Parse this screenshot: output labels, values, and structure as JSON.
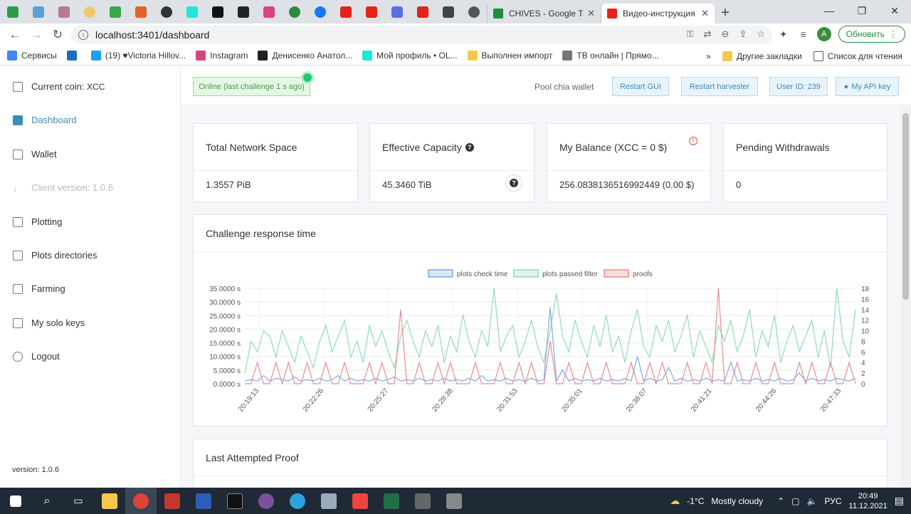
{
  "browser": {
    "tab_full_1": {
      "title": "CHIVES - Google Ta"
    },
    "tab_full_2": {
      "title": "Видео-инструкция"
    },
    "url": "localhost:3401/dashboard",
    "update_label": "Обновить",
    "avatar_letter": "A"
  },
  "bookmarks": {
    "items": [
      "Сервисы",
      "(19) ♥Victoria Hillov...",
      "Instagram",
      "Денисенко Анатол...",
      "Мой профиль • OL...",
      "Выполнен импорт",
      "ТВ онлайн | Прямо..."
    ],
    "more": "»",
    "other": "Другие закладки",
    "reading": "Список для чтения"
  },
  "sidebar": {
    "current_coin_label": "Current coin:",
    "current_coin_value": "XCC",
    "items": [
      "Dashboard",
      "Wallet",
      "Client version: 1.0.6",
      "Plotting",
      "Plots directories",
      "Farming",
      "My solo keys",
      "Logout"
    ],
    "version": "version: 1.0.6"
  },
  "topbar": {
    "status": "Online (last challenge 1 s ago)",
    "pool_wallet": "Pool chia wallet",
    "restart_gui": "Restart GUI",
    "restart_harvester": "Restart harvester",
    "user_id": "User ID: 239",
    "api_key": "My API key"
  },
  "stats": {
    "network_space_title": "Total Network Space",
    "network_space_value": "1.3557 PiB",
    "capacity_title": "Effective Capacity",
    "capacity_value": "45.3460 TiB",
    "balance_title": "My Balance (XCC = 0 $)",
    "balance_value": "256.0838136516992449 (0.00 $)",
    "pending_title": "Pending Withdrawals",
    "pending_value": "0"
  },
  "chart_card_title": "Challenge response time",
  "last_proof_title": "Last Attempted Proof",
  "chart_data": {
    "type": "line",
    "title": "Challenge response time",
    "x_tick_labels": [
      "20:19:13",
      "20:22:26",
      "20:25:27",
      "20:28:38",
      "20:31:53",
      "20:35:01",
      "20:38:07",
      "20:41:21",
      "20:44:26",
      "20:47:33"
    ],
    "y_left_ticks": [
      "35.0000 s",
      "30.0000 s",
      "25.0000 s",
      "20.0000 s",
      "15.0000 s",
      "10.0000 s",
      "5.0000 s",
      "0.0000 s"
    ],
    "y_right_ticks": [
      "18",
      "16",
      "14",
      "12",
      "10",
      "8",
      "6",
      "4",
      "2",
      "0"
    ],
    "ylim_left": [
      0,
      35
    ],
    "ylim_right": [
      0,
      18
    ],
    "legend_position": "top-center",
    "series": [
      {
        "name": "plots check time",
        "axis": "left",
        "color": "#7fa9e6",
        "values": [
          1,
          1.5,
          1,
          3,
          1,
          2,
          1.5,
          1,
          2.5,
          1,
          1.5,
          1,
          2,
          1,
          1.5,
          3,
          1,
          2,
          1,
          1.5,
          1,
          2,
          1,
          1.5,
          2.5,
          1,
          1.5,
          1,
          2,
          1,
          1.5,
          1,
          2,
          1,
          1.5,
          1,
          2,
          1,
          3,
          1,
          1.5,
          1,
          2,
          1,
          1.5,
          1,
          2,
          1,
          1.5,
          28,
          1,
          5,
          1,
          2,
          1,
          1.5,
          1,
          2,
          1,
          1.5,
          1,
          2,
          1,
          10,
          1,
          2,
          1,
          1.5,
          6,
          1,
          2,
          1,
          1.5,
          1,
          2,
          1,
          1.5,
          1,
          8,
          1,
          1.5,
          1,
          2,
          1,
          1.5,
          1,
          2,
          1,
          1.5,
          4,
          1,
          2,
          1,
          1.5,
          1,
          2,
          1.5,
          1,
          2
        ]
      },
      {
        "name": "plots passed filter",
        "axis": "right",
        "color": "#8fdcb5",
        "values": [
          2,
          8,
          6,
          10,
          9,
          5,
          10,
          7,
          4,
          9,
          6,
          3,
          8,
          11,
          6,
          9,
          12,
          5,
          8,
          4,
          11,
          7,
          10,
          6,
          3,
          9,
          12,
          8,
          5,
          10,
          7,
          11,
          4,
          9,
          6,
          13,
          8,
          5,
          10,
          7,
          18,
          6,
          9,
          11,
          5,
          8,
          12,
          7,
          4,
          10,
          17,
          9,
          6,
          12,
          8,
          5,
          11,
          7,
          13,
          6,
          9,
          4,
          10,
          14,
          7,
          5,
          11,
          8,
          12,
          6,
          9,
          13,
          5,
          10,
          7,
          4,
          11,
          8,
          12,
          6,
          9,
          14,
          5,
          10,
          7,
          13,
          4,
          8,
          11,
          6,
          9,
          12,
          5,
          10,
          3,
          18,
          8,
          5,
          14
        ]
      },
      {
        "name": "proofs",
        "axis": "right",
        "color": "#ee8c8c",
        "values": [
          0,
          0,
          4,
          0,
          0,
          4,
          0,
          4,
          0,
          0,
          4,
          0,
          0,
          4,
          0,
          0,
          4,
          0,
          0,
          0,
          4,
          0,
          4,
          0,
          0,
          14,
          0,
          0,
          4,
          0,
          0,
          4,
          0,
          4,
          0,
          0,
          0,
          4,
          0,
          0,
          0,
          4,
          0,
          0,
          4,
          0,
          4,
          0,
          0,
          8,
          0,
          0,
          4,
          0,
          0,
          4,
          0,
          0,
          4,
          0,
          0,
          0,
          4,
          0,
          0,
          4,
          0,
          4,
          0,
          0,
          0,
          4,
          0,
          0,
          4,
          0,
          18,
          0,
          0,
          4,
          0,
          0,
          4,
          0,
          0,
          4,
          0,
          0,
          0,
          4,
          0,
          4,
          0,
          0,
          4,
          0,
          0,
          4,
          0
        ]
      }
    ]
  }
}
